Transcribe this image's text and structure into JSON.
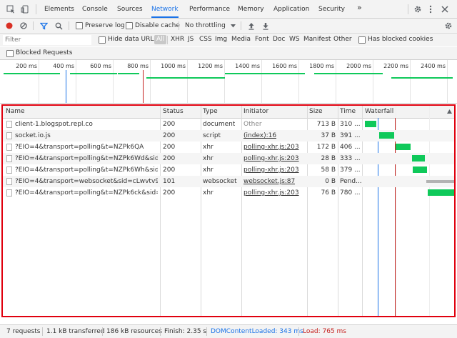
{
  "tabs": [
    {
      "label": "Elements"
    },
    {
      "label": "Console"
    },
    {
      "label": "Sources"
    },
    {
      "label": "Network"
    },
    {
      "label": "Performance"
    },
    {
      "label": "Memory"
    },
    {
      "label": "Application"
    },
    {
      "label": "Security"
    }
  ],
  "more_tabs": "»",
  "toolbar": {
    "preserve_log": "Preserve log",
    "disable_cache": "Disable cache",
    "throttling": "No throttling"
  },
  "filter": {
    "placeholder": "Filter",
    "hide_data_urls": "Hide data URLs",
    "all": "All",
    "types": [
      "XHR",
      "JS",
      "CSS",
      "Img",
      "Media",
      "Font",
      "Doc",
      "WS",
      "Manifest",
      "Other"
    ],
    "has_blocked_cookies": "Has blocked cookies",
    "blocked_requests": "Blocked Requests"
  },
  "overview": {
    "ticks": [
      "200 ms",
      "400 ms",
      "600 ms",
      "800 ms",
      "1000 ms",
      "1200 ms",
      "1400 ms",
      "1600 ms",
      "1800 ms",
      "2000 ms",
      "2200 ms",
      "2400 ms"
    ]
  },
  "table": {
    "headers": {
      "name": "Name",
      "status": "Status",
      "type": "Type",
      "initiator": "Initiator",
      "size": "Size",
      "time": "Time",
      "waterfall": "Waterfall"
    },
    "rows": [
      {
        "name": "client-1.blogspot.repl.co",
        "status": "200",
        "type": "document",
        "initiator": "Other",
        "size": "713 B",
        "time": "310 ..."
      },
      {
        "name": "socket.io.js",
        "status": "200",
        "type": "script",
        "initiator": "(index):16",
        "size": "37 B",
        "time": "391 ..."
      },
      {
        "name": "?EIO=4&transport=polling&t=NZPk6QA",
        "status": "200",
        "type": "xhr",
        "initiator": "polling-xhr.js:203",
        "size": "172 B",
        "time": "406 ..."
      },
      {
        "name": "?EIO=4&transport=polling&t=NZPk6Wd&sid=c...",
        "status": "200",
        "type": "xhr",
        "initiator": "polling-xhr.js:203",
        "size": "28 B",
        "time": "333 ..."
      },
      {
        "name": "?EIO=4&transport=polling&t=NZPk6Wh&sid=c...",
        "status": "200",
        "type": "xhr",
        "initiator": "polling-xhr.js:203",
        "size": "58 B",
        "time": "379 ..."
      },
      {
        "name": "?EIO=4&transport=websocket&sid=cLwvtv934B...",
        "status": "101",
        "type": "websocket",
        "initiator": "websocket.js:87",
        "size": "0 B",
        "time": "Pend..."
      },
      {
        "name": "?EIO=4&transport=polling&t=NZPk6ck&sid=cL...",
        "status": "200",
        "type": "xhr",
        "initiator": "polling-xhr.js:203",
        "size": "76 B",
        "time": "780 ..."
      }
    ]
  },
  "statusbar": {
    "requests": "7 requests",
    "transferred": "1.1 kB transferred",
    "resources": "186 kB resources",
    "finish": "Finish: 2.35 s",
    "dom_content_loaded": "DOMContentLoaded: 343 ms",
    "load": "Load: 765 ms"
  },
  "colors": {
    "accent": "#1a73e8",
    "record": "#d93025",
    "highlight_border": "#e0000e",
    "bar_green": "#0fc95a",
    "dcl_blue": "#1a73e8",
    "load_red": "#c5221f",
    "pending_gray": "#b3b3b3"
  },
  "icons": [
    "inspect-icon",
    "device-toolbar-icon",
    "settings-icon",
    "kebab-menu-icon",
    "close-icon",
    "record-icon",
    "clear-icon",
    "filter-icon",
    "search-icon",
    "upload-icon",
    "download-icon",
    "file-icon"
  ]
}
